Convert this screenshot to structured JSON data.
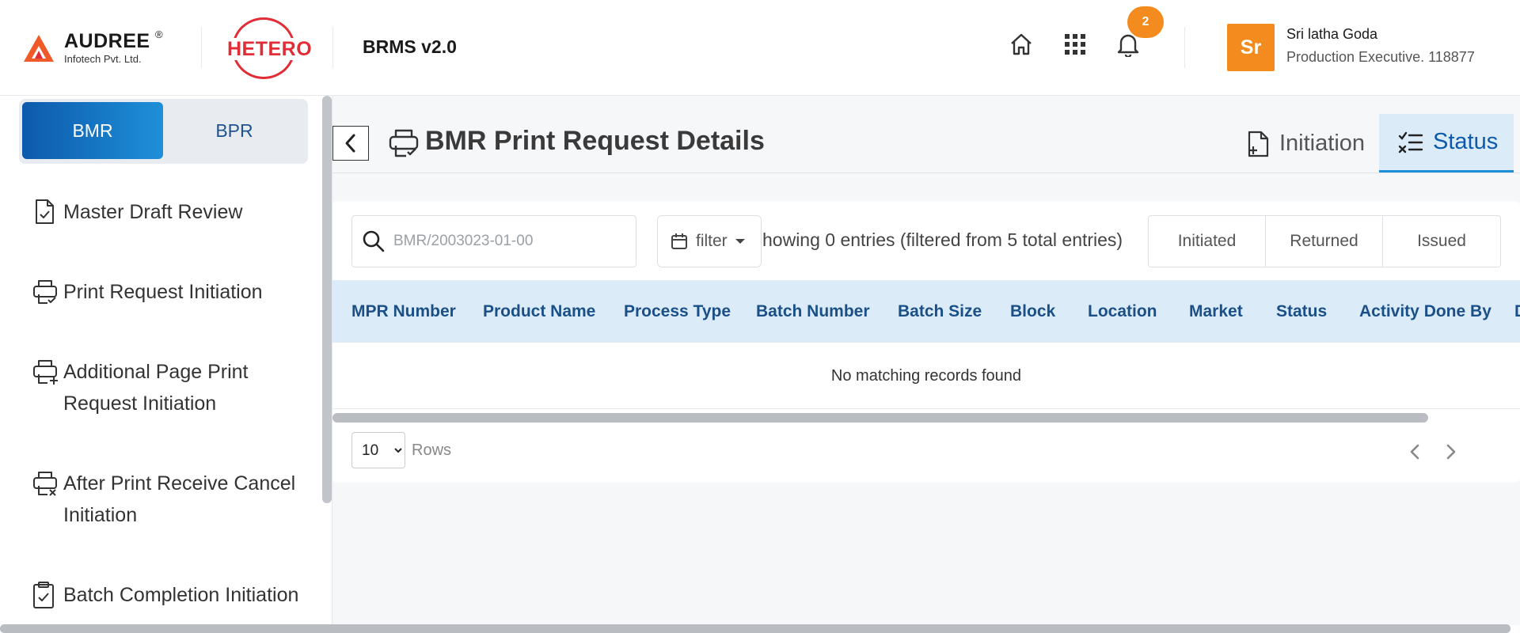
{
  "header": {
    "brand": {
      "name": "AUDREE",
      "reg": "®",
      "sub": "Infotech Pvt. Ltd."
    },
    "client_logo": "HETERO",
    "app_title": "BRMS v2.0",
    "notification_count": "2",
    "user": {
      "initials": "Sr",
      "name": "Sri latha Goda",
      "role": "Production Executive. 118877"
    },
    "colors": {
      "accent": "#f38b1f",
      "brand_red": "#e02d36"
    }
  },
  "sidebar": {
    "toggle": {
      "bmr": "BMR",
      "bpr": "BPR",
      "active": "BMR"
    },
    "items": [
      {
        "label": "Master Draft Review",
        "icon": "file-check-icon"
      },
      {
        "label": "Print Request Initiation",
        "icon": "printer-check-icon"
      },
      {
        "label": "Additional Page Print Request Initiation",
        "icon": "printer-plus-icon"
      },
      {
        "label": "After Print Receive Cancel Initiation",
        "icon": "printer-x-icon"
      },
      {
        "label": "Batch Completion Initiation",
        "icon": "clipboard-check-icon"
      }
    ]
  },
  "main": {
    "title": "BMR Print Request Details",
    "tabs": {
      "initiation": "Initiation",
      "status": "Status",
      "active": "Status"
    },
    "search": {
      "placeholder": "BMR/2003023-01-00",
      "value": ""
    },
    "filter_label": "filter",
    "entries_text": "howing 0 entries (filtered from 5 total entries)",
    "status_filters": [
      "Initiated",
      "Returned",
      "Issued"
    ],
    "table": {
      "columns": [
        "MPR Number",
        "Product Name",
        "Process Type",
        "Batch Number",
        "Batch Size",
        "Block",
        "Location",
        "Market",
        "Status",
        "Activity Done By",
        "D"
      ],
      "empty_message": "No matching records found"
    },
    "pagination": {
      "rows_value": "10",
      "rows_options": [
        "10"
      ],
      "rows_label": "Rows"
    },
    "colors": {
      "primary": "#0d5aab",
      "header_bg": "#dbecf8"
    }
  }
}
